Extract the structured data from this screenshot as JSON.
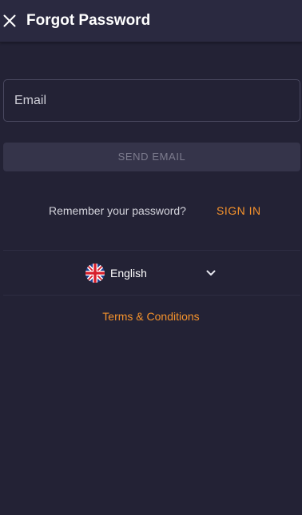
{
  "header": {
    "title": "Forgot Password",
    "close_icon": "close-icon"
  },
  "form": {
    "email_placeholder": "Email",
    "email_value": "",
    "send_button_label": "SEND EMAIL",
    "send_button_enabled": false
  },
  "signin_prompt": {
    "text": "Remember your password?",
    "link_label": "SIGN IN"
  },
  "language": {
    "selected": "English",
    "flag_icon": "uk-flag-icon",
    "dropdown_icon": "chevron-down-icon"
  },
  "footer": {
    "terms_label": "Terms & Conditions"
  },
  "colors": {
    "background": "#232235",
    "header_background": "#2a2940",
    "accent": "#f5922c",
    "disabled_button": "#35344a",
    "disabled_text": "#7d7c8e"
  }
}
